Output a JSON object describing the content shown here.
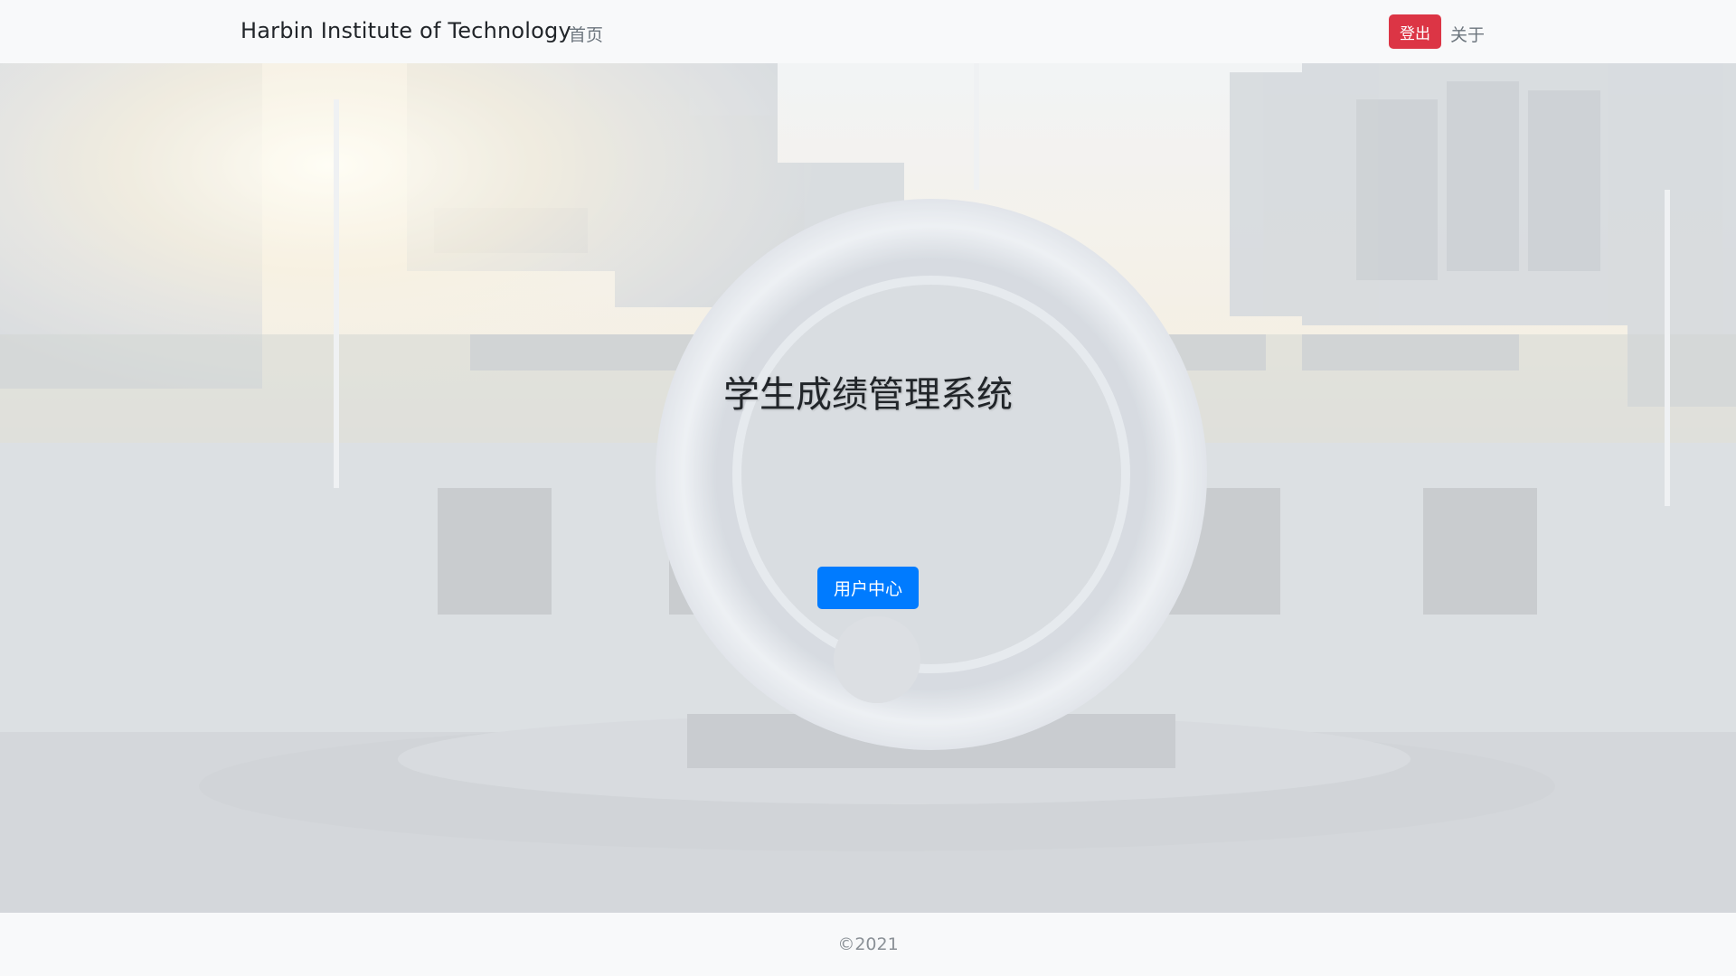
{
  "navbar": {
    "brand": "Harbin Institute of Technology",
    "home_label": "首页",
    "logout_label": "登出",
    "about_label": "关于"
  },
  "hero": {
    "title": "学生成绩管理系统",
    "user_center_label": "用户中心"
  },
  "footer": {
    "copyright": "©2021"
  },
  "colors": {
    "navbar_bg": "#f8f9fa",
    "logout_red": "#dc3545",
    "primary_blue": "#007bff",
    "title_text": "#212529",
    "muted_text": "#6c757d"
  }
}
